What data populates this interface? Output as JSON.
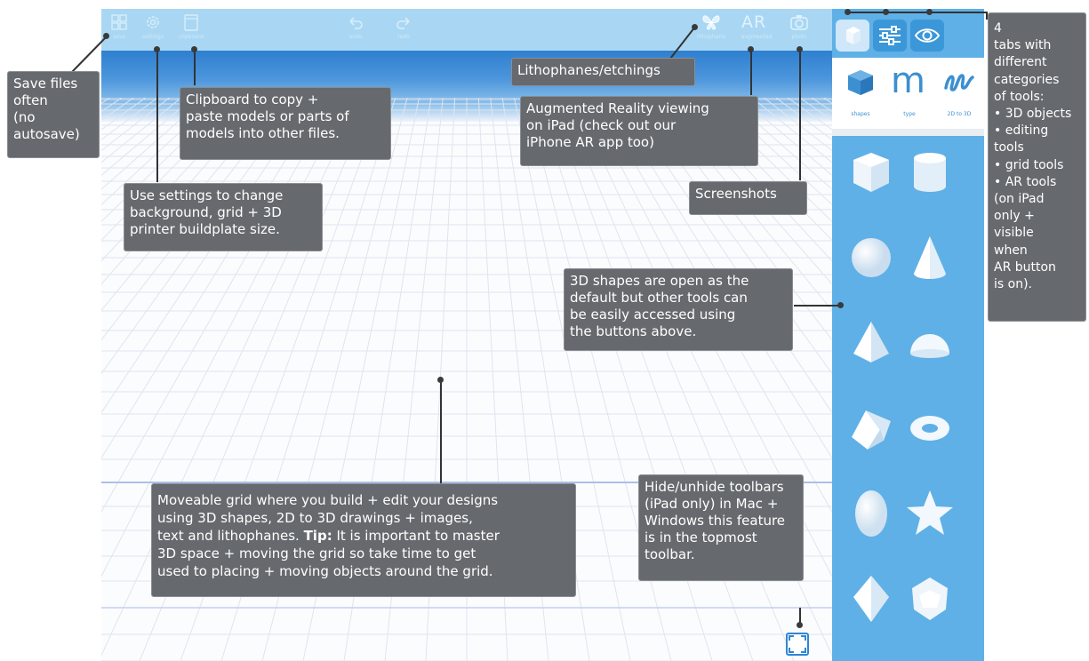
{
  "top_toolbar": {
    "left_items": [
      {
        "icon": "grid-icon",
        "label": "save"
      },
      {
        "icon": "gear-icon",
        "label": "settings"
      },
      {
        "icon": "clipboard-icon",
        "label": "clipboard"
      }
    ],
    "center_items": [
      {
        "icon": "undo-icon",
        "label": "undo"
      },
      {
        "icon": "redo-icon",
        "label": "redo"
      }
    ],
    "right_items": [
      {
        "icon": "butterfly-icon",
        "label": "lithophane"
      },
      {
        "icon": "ar-icon",
        "text": "AR",
        "label": "augmented"
      },
      {
        "icon": "camera-icon",
        "label": "photo"
      }
    ]
  },
  "sidebar": {
    "tabs": [
      {
        "icon": "cube-tab-icon",
        "active": true
      },
      {
        "icon": "sliders-tab-icon",
        "active": false
      },
      {
        "icon": "eye-tab-icon",
        "active": false
      }
    ],
    "tool_buttons": [
      {
        "icon": "cube-icon",
        "label": "shapes"
      },
      {
        "icon": "text-m-icon",
        "label": "type"
      },
      {
        "icon": "scribble-icon",
        "label": "2D to 3D"
      }
    ],
    "shapes": [
      "cube",
      "cylinder",
      "sphere",
      "cone",
      "pyramid",
      "hemisphere",
      "prism",
      "torus",
      "ellipsoid",
      "star",
      "octahedron",
      "dodecahedron"
    ]
  },
  "annotations": {
    "save": "Save files\noften\n(no\n autosave)",
    "clipboard": "Clipboard to copy +\npaste models  or parts of\nmodels into other files.",
    "settings": "Use settings to change\nbackground, grid + 3D\nprinter buildplate size.",
    "lithophanes": "Lithophanes/etchings",
    "ar": "Augmented Reality viewing\non iPad (check out our\niPhone AR app too)",
    "screenshots": "Screenshots",
    "tabs": "4\ntabs with\ndifferent\ncategories\nof tools:\n• 3D objects\n• editing\ntools\n• grid tools\n• AR tools\n(on iPad\nonly +\nvisible\nwhen\nAR button\nis on).",
    "shapes_default": "3D shapes are open as the\ndefault but other tools can\nbe easily accessed using\nthe buttons above.",
    "grid_part1": "Moveable grid where you build + edit your designs\nusing 3D shapes, 2D to 3D drawings + images,\ntext and lithophanes. ",
    "grid_tip_label": "Tip:",
    "grid_part2": " It is important to master\n3D space + moving the grid so take time to get\nused to placing + moving objects around the grid.",
    "toolbars": "Hide/unhide toolbars\n(iPad only) in Mac +\nWindows this feature\nis in the topmost\ntoolbar."
  },
  "colors": {
    "toolbar_bg": "#a9d7f3",
    "sidebar_bg": "#5fb0e7",
    "accent_blue": "#2f86d3",
    "note_bg": "#666a6e"
  }
}
